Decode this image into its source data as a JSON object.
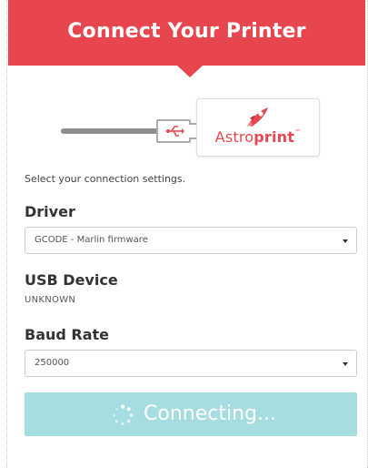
{
  "header": {
    "title": "Connect Your Printer"
  },
  "illustration": {
    "cable_icon": "usb-cable-icon",
    "usb_glyph": "⭨",
    "logo": {
      "text_light": "Astro",
      "text_bold": "print",
      "tm": "™"
    }
  },
  "form": {
    "intro": "Select your connection settings.",
    "driver": {
      "label": "Driver",
      "selected": "GCODE - Marlin firmware"
    },
    "usb_device": {
      "label": "USB Device",
      "value": "UNKNOWN"
    },
    "baud_rate": {
      "label": "Baud Rate",
      "selected": "250000"
    },
    "connect_button": {
      "label": "Connecting..."
    }
  },
  "colors": {
    "accent": "#e8464f",
    "button": "#a6dde0",
    "cable": "#8f8f8f"
  }
}
